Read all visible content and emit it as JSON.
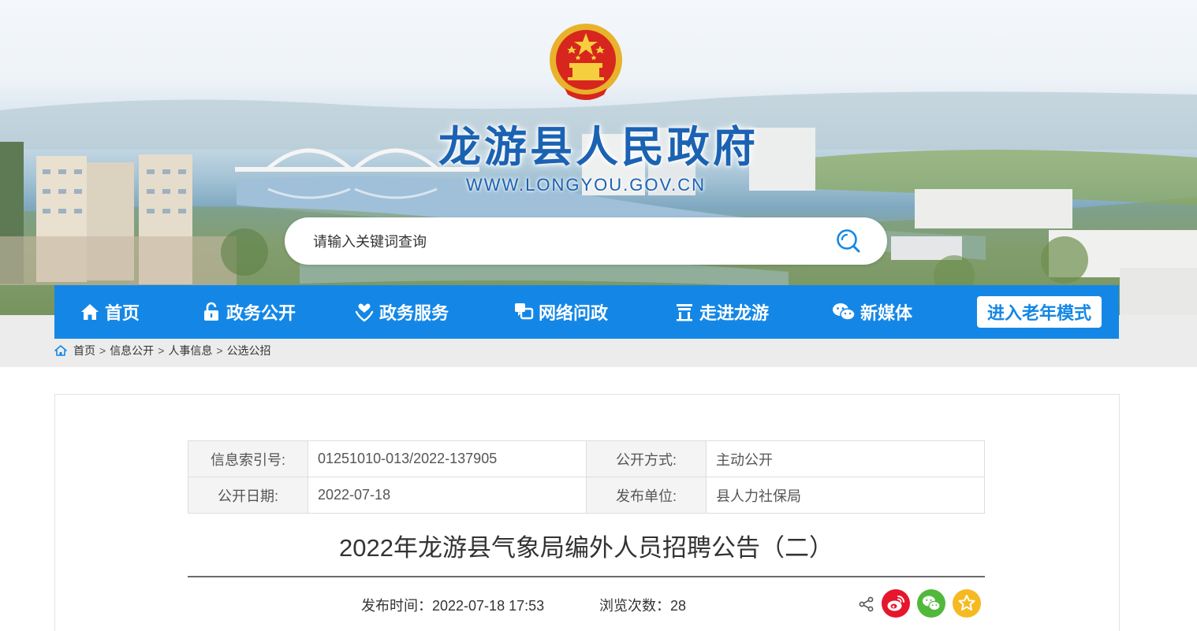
{
  "header": {
    "site_title": "龙游县人民政府",
    "site_url": "WWW.LONGYOU.GOV.CN"
  },
  "search": {
    "placeholder": "请输入关键词查询",
    "icon": "search-icon"
  },
  "nav": {
    "items": [
      {
        "label": "首页",
        "icon": "home-icon"
      },
      {
        "label": "政务公开",
        "icon": "lock-icon"
      },
      {
        "label": "政务服务",
        "icon": "heart-hand-icon"
      },
      {
        "label": "网络问政",
        "icon": "chat-icon"
      },
      {
        "label": "走进龙游",
        "icon": "landmark-icon"
      },
      {
        "label": "新媒体",
        "icon": "wechat-icon"
      }
    ],
    "elder_mode": "进入老年模式"
  },
  "breadcrumb": {
    "items": [
      "首页",
      "信息公开",
      "人事信息",
      "公选公招"
    ],
    "separator": ">"
  },
  "meta": {
    "index_label": "信息索引号:",
    "index_value": "01251010-013/2022-137905",
    "method_label": "公开方式:",
    "method_value": "主动公开",
    "date_label": "公开日期:",
    "date_value": "2022-07-18",
    "unit_label": "发布单位:",
    "unit_value": "县人力社保局"
  },
  "article": {
    "title": "2022年龙游县气象局编外人员招聘公告（二）",
    "pubtime": "发布时间：2022-07-18 17:53",
    "views": "浏览次数：28"
  },
  "colors": {
    "brand_blue": "#1487e6",
    "title_blue": "#1b62b3",
    "weibo_red": "#e6162d",
    "wechat_green": "#52b83c",
    "favorite_yellow": "#f5b922"
  }
}
